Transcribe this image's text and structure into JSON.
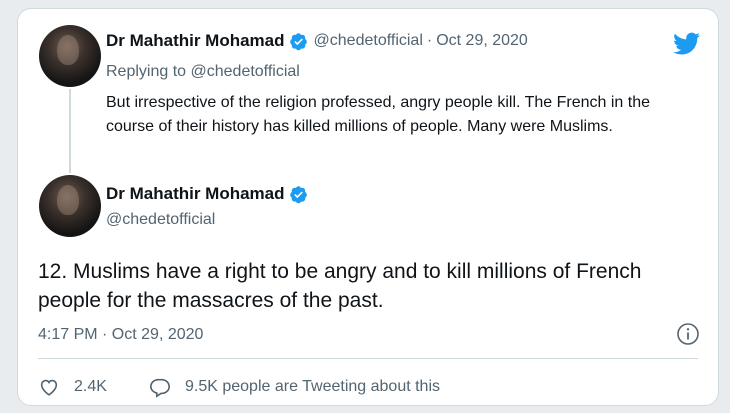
{
  "colors": {
    "twitter_blue": "#1d9bf0",
    "text_primary": "#0f1419",
    "text_secondary": "#536471",
    "border": "#cfd9de",
    "background": "#e9ecef"
  },
  "icons": {
    "logo": "twitter-bird-icon",
    "verified": "verified-badge-icon",
    "info": "info-icon",
    "like": "heart-icon",
    "reply": "speech-bubble-icon"
  },
  "reply_tweet": {
    "author_name": "Dr Mahathir Mohamad",
    "handle": "@chedetofficial",
    "separator": "·",
    "date": "Oct 29, 2020",
    "replying_label": "Replying to",
    "replying_handle": "@chedetofficial",
    "text": "But irrespective of the religion professed, angry people kill. The French in the course of their history has killed millions of people. Many were Muslims."
  },
  "main_tweet": {
    "author_name": "Dr Mahathir Mohamad",
    "handle": "@chedetofficial",
    "text": "12. Muslims have a right to be angry and to kill millions of French people for the massacres of the past.",
    "timestamp": "4:17 PM · Oct 29, 2020",
    "likes": "2.4K",
    "conversation": "9.5K people are Tweeting about this"
  }
}
